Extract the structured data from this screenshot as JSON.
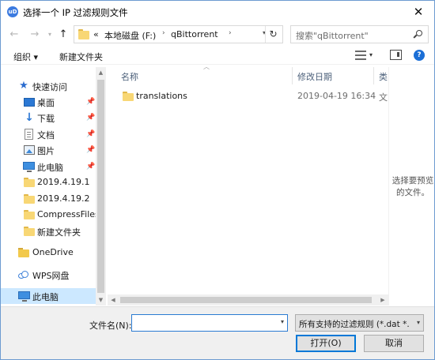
{
  "window": {
    "app_icon": "uD",
    "title": "选择一个 IP 过滤规则文件",
    "close_glyph": "✕"
  },
  "nav": {
    "back_glyph": "←",
    "forward_glyph": "→",
    "recent_glyph": "▾",
    "up_glyph": "↑",
    "breadcrumb": [
      "«",
      "本地磁盘 (F:)",
      "qBittorrent"
    ],
    "breadcrumb_sep": "›",
    "refresh_glyph": "↻",
    "search_placeholder": "搜索\"qBittorrent\""
  },
  "toolbar": {
    "organize": "组织 ▾",
    "new_folder": "新建文件夹"
  },
  "sidebar": {
    "items": [
      {
        "label": "快速访问",
        "icon": "star-icon"
      },
      {
        "label": "桌面",
        "icon": "desktop-icon",
        "pinned": true
      },
      {
        "label": "下载",
        "icon": "download-icon",
        "pinned": true
      },
      {
        "label": "文档",
        "icon": "document-icon",
        "pinned": true
      },
      {
        "label": "图片",
        "icon": "picture-icon",
        "pinned": true
      },
      {
        "label": "此电脑",
        "icon": "computer-icon",
        "pinned": true
      },
      {
        "label": "2019.4.19.1",
        "icon": "folder-icon"
      },
      {
        "label": "2019.4.19.2",
        "icon": "folder-icon"
      },
      {
        "label": "CompressFiles",
        "icon": "folder-icon"
      },
      {
        "label": "新建文件夹",
        "icon": "folder-icon"
      },
      {
        "label": "OneDrive",
        "icon": "onedrive-icon"
      },
      {
        "label": "WPS网盘",
        "icon": "cloud-icon"
      },
      {
        "label": "此电脑",
        "icon": "computer-icon",
        "selected": true
      }
    ],
    "pin_glyph": "📌"
  },
  "filelist": {
    "columns": [
      "名称",
      "修改日期",
      "类"
    ],
    "rows": [
      {
        "name": "translations",
        "modified": "2019-04-19 16:34",
        "type": "文"
      }
    ]
  },
  "preview": {
    "empty_text": "选择要预览的文件。"
  },
  "footer": {
    "filename_label": "文件名(N):",
    "filename_value": "",
    "filter_value": "所有支持的过滤规则 (*.dat *.p",
    "open_label": "打开(O)",
    "cancel_label": "取消"
  },
  "colors": {
    "accent": "#0078d7",
    "selection": "#cce8ff",
    "folder": "#f8d775"
  }
}
